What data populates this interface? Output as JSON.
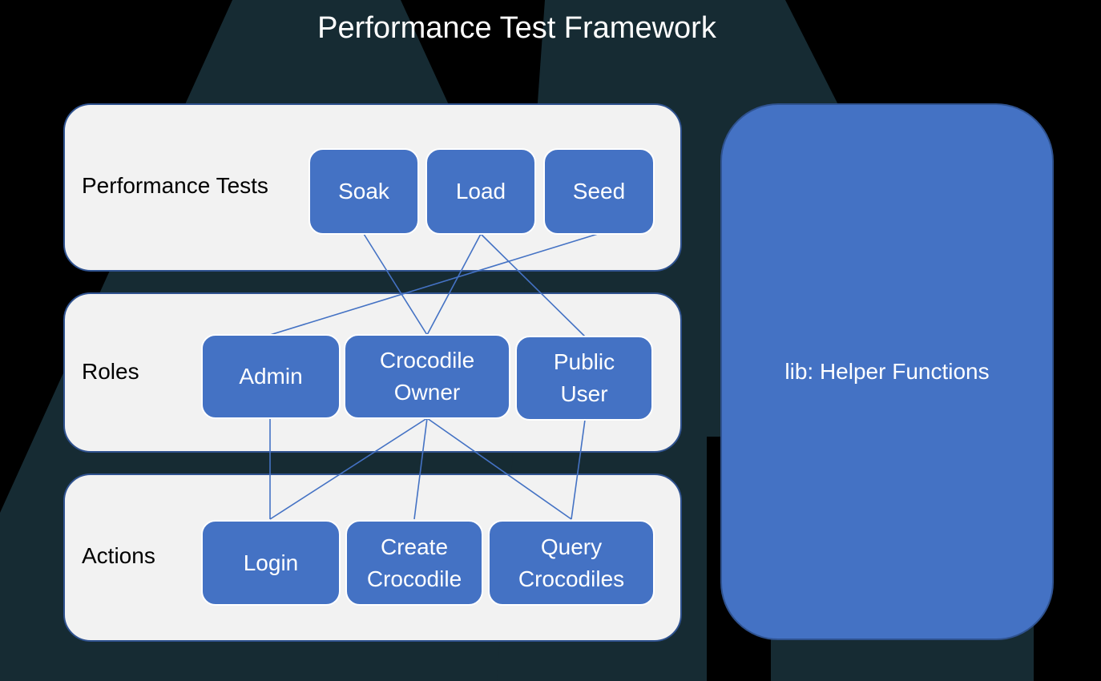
{
  "title": "Performance Test Framework",
  "colors": {
    "background": "#000000",
    "background_shape": "#162b33",
    "panel_fill": "#f2f2f2",
    "panel_border": "#2f528f",
    "node_fill": "#4472c4",
    "link": "#4472c4"
  },
  "layers": {
    "tests": {
      "label": "Performance Tests",
      "nodes": {
        "soak": "Soak",
        "load": "Load",
        "seed": "Seed"
      }
    },
    "roles": {
      "label": "Roles",
      "nodes": {
        "admin": "Admin",
        "owner_line1": "Crocodile",
        "owner_line2": "Owner",
        "public_line1": "Public",
        "public_line2": "User"
      }
    },
    "actions": {
      "label": "Actions",
      "nodes": {
        "login": "Login",
        "create_line1": "Create",
        "create_line2": "Crocodile",
        "query_line1": "Query",
        "query_line2": "Crocodiles"
      }
    }
  },
  "lib": {
    "label": "lib: Helper Functions"
  },
  "links": [
    {
      "from": "Soak",
      "to": "Crocodile Owner"
    },
    {
      "from": "Load",
      "to": "Crocodile Owner"
    },
    {
      "from": "Load",
      "to": "Public User"
    },
    {
      "from": "Seed",
      "to": "Admin"
    },
    {
      "from": "Admin",
      "to": "Login"
    },
    {
      "from": "Crocodile Owner",
      "to": "Login"
    },
    {
      "from": "Crocodile Owner",
      "to": "Create Crocodile"
    },
    {
      "from": "Crocodile Owner",
      "to": "Query Crocodiles"
    },
    {
      "from": "Public User",
      "to": "Query Crocodiles"
    }
  ]
}
